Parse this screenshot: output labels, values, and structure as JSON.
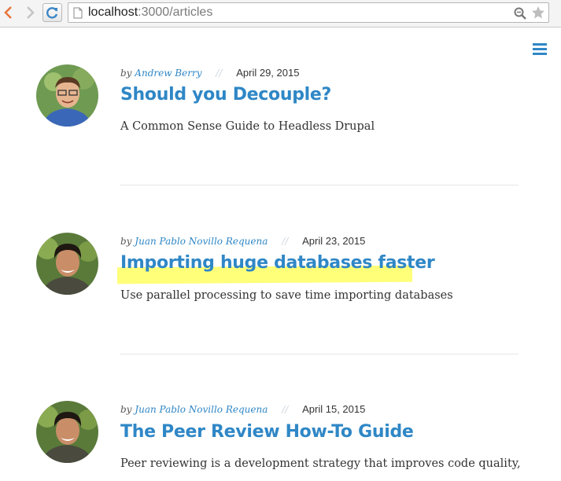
{
  "browser": {
    "url_host": "localhost",
    "url_rest": ":3000/articles"
  },
  "articles": [
    {
      "by": "by",
      "author": "Andrew Berry",
      "separator": "//",
      "date": "April 29, 2015",
      "title": "Should you Decouple?",
      "summary": "A Common Sense Guide to Headless Drupal"
    },
    {
      "by": "by",
      "author": "Juan Pablo Novillo Requena",
      "separator": "//",
      "date": "April 23, 2015",
      "title": "Importing huge databases faster",
      "summary": "Use parallel processing to save time importing databases"
    },
    {
      "by": "by",
      "author": "Juan Pablo Novillo Requena",
      "separator": "//",
      "date": "April 15, 2015",
      "title": "The Peer Review How-To Guide",
      "summary": "Peer reviewing is a development strategy that improves code quality,"
    }
  ],
  "colors": {
    "link": "#2f87c6",
    "highlight": "#ffff7a"
  }
}
